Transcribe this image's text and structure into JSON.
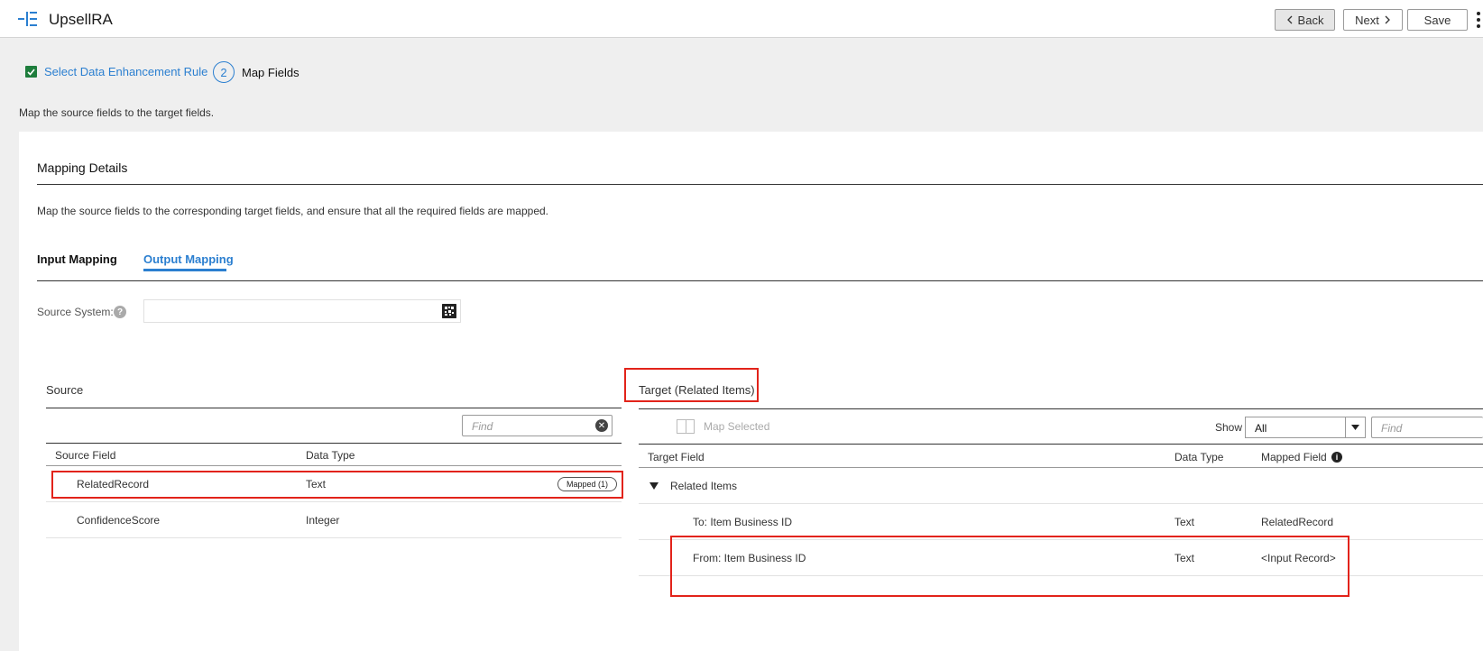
{
  "header": {
    "app_title": "UpsellRA",
    "back_label": "Back",
    "next_label": "Next",
    "save_label": "Save"
  },
  "steps": {
    "step1_label": "Select Data Enhancement Rule",
    "step2_number": "2",
    "step2_label": "Map Fields"
  },
  "page": {
    "description": "Map the source fields to the target fields."
  },
  "mapping": {
    "title": "Mapping Details",
    "description": "Map the source fields to the corresponding target fields, and ensure that all the required fields are mapped.",
    "tabs": [
      {
        "label": "Input Mapping",
        "active": false
      },
      {
        "label": "Output Mapping",
        "active": true
      }
    ],
    "source_system_label": "Source System:",
    "source_system_value": ""
  },
  "source": {
    "title": "Source",
    "find_placeholder": "Find",
    "columns": [
      "Source Field",
      "Data Type"
    ],
    "rows": [
      {
        "field": "RelatedRecord",
        "type": "Text",
        "badge": "Mapped (1)"
      },
      {
        "field": "ConfidenceScore",
        "type": "Integer",
        "badge": ""
      }
    ]
  },
  "target": {
    "title": "Target (Related Items)",
    "map_selected_label": "Map Selected",
    "show_label": "Show",
    "show_value": "All",
    "find_placeholder": "Find",
    "columns": [
      "Target Field",
      "Data Type",
      "Mapped Field"
    ],
    "group_label": "Related Items",
    "rows": [
      {
        "field": "To: Item Business ID",
        "type": "Text",
        "mapped": "RelatedRecord"
      },
      {
        "field": "From: Item Business ID",
        "type": "Text",
        "mapped": "<Input Record>"
      }
    ]
  },
  "colors": {
    "accent": "#2b7fd0",
    "highlight": "#e2231a",
    "check": "#1e7d3c"
  }
}
